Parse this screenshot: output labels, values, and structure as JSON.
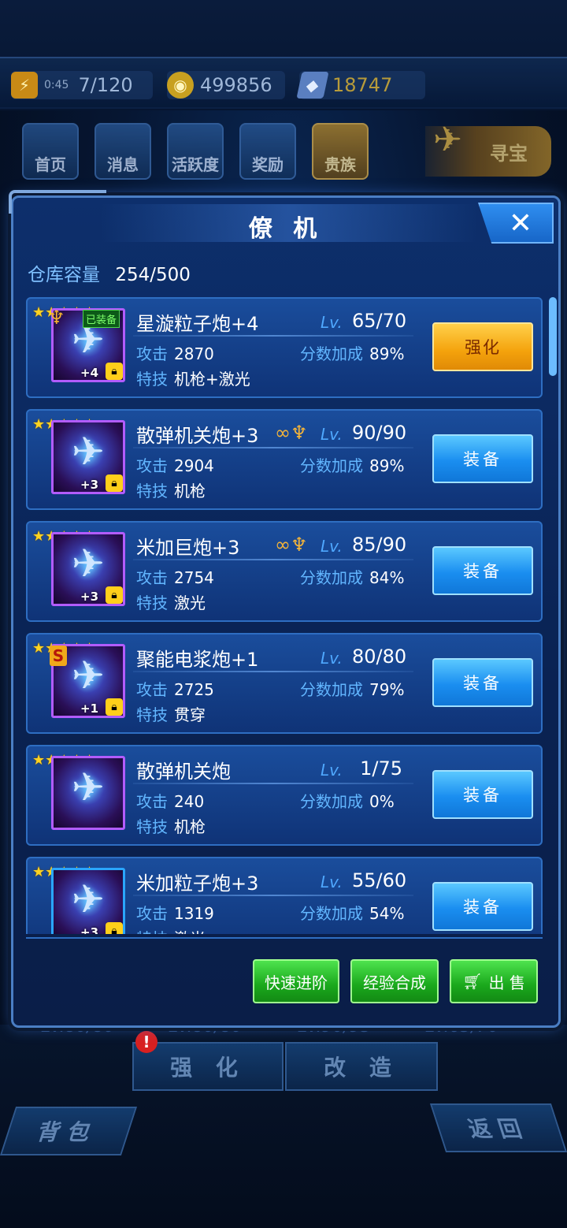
{
  "status_bar": {
    "timer": "0:45",
    "energy": "7/120",
    "gold": "499856",
    "gems": "18747"
  },
  "nav": {
    "items": [
      "首页",
      "消息",
      "活跃度",
      "奖励",
      "贵族"
    ],
    "treasure": "寻宝"
  },
  "modal": {
    "title": "僚 机",
    "close_glyph": "✕",
    "capacity_label": "仓库容量",
    "capacity_value": "254/500",
    "lv_label": "Lv.",
    "attack_label": "攻击",
    "bonus_label": "分数加成",
    "skill_label": "特技",
    "star_glyph": "★★★★★",
    "items": [
      {
        "name": "星漩粒子炮+4",
        "lv": "65/70",
        "attack": "2870",
        "bonus": "89%",
        "skill": "机枪+激光",
        "plus": "+4",
        "equipped_tag": "已装备",
        "action": "强化"
      },
      {
        "name": "散弹机关炮+3",
        "lv": "90/90",
        "attack": "2904",
        "bonus": "89%",
        "skill": "机枪",
        "plus": "+3",
        "action": "装备"
      },
      {
        "name": "米加巨炮+3",
        "lv": "85/90",
        "attack": "2754",
        "bonus": "84%",
        "skill": "激光",
        "plus": "+3",
        "action": "装备"
      },
      {
        "name": "聚能电浆炮+1",
        "lv": "80/80",
        "attack": "2725",
        "bonus": "79%",
        "skill": "贯穿",
        "plus": "+1",
        "grade": "S",
        "action": "装备"
      },
      {
        "name": "散弹机关炮",
        "lv": "1/75",
        "attack": "240",
        "bonus": "0%",
        "skill": "机枪",
        "plus": "",
        "action": "装备"
      },
      {
        "name": "米加粒子炮+3",
        "lv": "55/60",
        "attack": "1319",
        "bonus": "54%",
        "skill": "激光",
        "plus": "+3",
        "action": "装备"
      }
    ],
    "footer": {
      "quick_advance": "快速进阶",
      "exp_merge": "经验合成",
      "sell": "出 售"
    }
  },
  "background": {
    "lv_strip": [
      "Lv.80/80",
      "Lv.80/80",
      "Lv.90/95",
      "Lv.65/70"
    ],
    "notice_badge": "!",
    "strengthen": "强 化",
    "modify": "改 造",
    "bag": "背包",
    "back": "返回"
  }
}
